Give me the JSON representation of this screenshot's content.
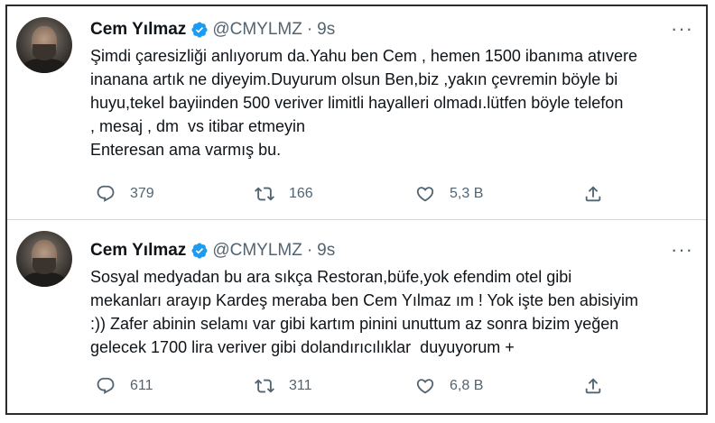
{
  "tweets": [
    {
      "name": "Cem Yılmaz",
      "handle": "@CMYLMZ",
      "separator": "·",
      "time": "9s",
      "more": "···",
      "lines": [
        "Şimdi çaresizliği anlıyorum da.Yahu ben Cem , hemen 1500 ibanıma atıvere",
        "inanana artık ne diyeyim.Duyurum olsun Ben,biz ,yakın çevremin böyle bi",
        "huyu,tekel bayiinden 500 veriver limitli hayalleri olmadı.lütfen böyle telefon",
        ", mesaj , dm  vs itibar etmeyin",
        "Enteresan ama varmış bu."
      ],
      "replies": "379",
      "retweets": "166",
      "likes": "5,3 B"
    },
    {
      "name": "Cem Yılmaz",
      "handle": "@CMYLMZ",
      "separator": "·",
      "time": "9s",
      "more": "···",
      "lines": [
        "Sosyal medyadan bu ara sıkça Restoran,büfe,yok efendim otel gibi",
        "mekanları arayıp Kardeş meraba ben Cem Yılmaz ım ! Yok işte ben abisiyim",
        ":)) Zafer abinin selamı var gibi kartım pinini unuttum az sonra bizim yeğen",
        "gelecek 1700 lira veriver gibi dolandırıcılıklar  duyuyorum +"
      ],
      "replies": "611",
      "retweets": "311",
      "likes": "6,8 B"
    }
  ],
  "icons": {
    "verified": "verified-badge-icon",
    "reply": "reply-icon",
    "retweet": "retweet-icon",
    "like": "heart-icon",
    "share": "share-icon",
    "more": "more-options-icon"
  },
  "colors": {
    "verified": "#1d9bf0",
    "secondary_text": "#536471",
    "primary_text": "#0f1419",
    "divider": "#cfd9de"
  }
}
